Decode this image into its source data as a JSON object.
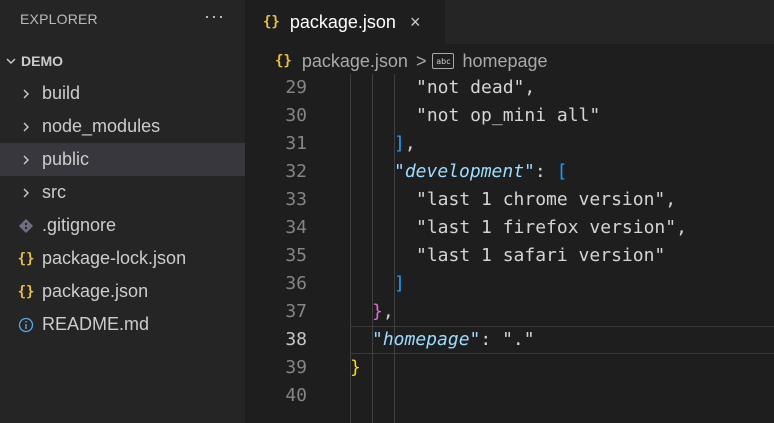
{
  "sidebar": {
    "title": "EXPLORER",
    "more_icon": "ellipsis-icon",
    "root_label": "DEMO",
    "items": [
      {
        "label": "build",
        "icon": "chevron-right-icon"
      },
      {
        "label": "node_modules",
        "icon": "chevron-right-icon"
      },
      {
        "label": "public",
        "icon": "chevron-right-icon",
        "selected": true
      },
      {
        "label": "src",
        "icon": "chevron-right-icon"
      },
      {
        "label": ".gitignore",
        "icon": "git-icon"
      },
      {
        "label": "package-lock.json",
        "icon": "json-icon"
      },
      {
        "label": "package.json",
        "icon": "json-icon"
      },
      {
        "label": "README.md",
        "icon": "info-icon"
      }
    ]
  },
  "tab": {
    "label": "package.json",
    "icon": "json-icon",
    "close": "×"
  },
  "breadcrumb": {
    "file": "package.json",
    "separator": ">",
    "symbol": "homepage",
    "symbol_icon": "abc"
  },
  "editor": {
    "line_numbers": [
      "29",
      "30",
      "31",
      "32",
      "33",
      "34",
      "35",
      "36",
      "37",
      "38",
      "39",
      "40"
    ],
    "lines": {
      "l29": "\"not dead\"",
      "l30": "\"not op_mini all\"",
      "l31_bracket": "]",
      "l31_comma": ",",
      "l32_key": "\"development\"",
      "l32_colon": ": ",
      "l32_bracket": "[",
      "l33": "\"last 1 chrome version\"",
      "l34": "\"last 1 firefox version\"",
      "l35": "\"last 1 safari version\"",
      "l36_bracket": "]",
      "l37_brace": "}",
      "l37_comma": ",",
      "l38_key": "\"homepage\"",
      "l38_colon": ": ",
      "l38_value": "\".\"",
      "l39_brace": "}",
      "comma": ","
    }
  },
  "colors": {
    "background": "#1e1e1e",
    "sidebar": "#252526",
    "json_icon": "#e8c03e",
    "key": "#9cdcfe",
    "string": "#ce9178"
  }
}
